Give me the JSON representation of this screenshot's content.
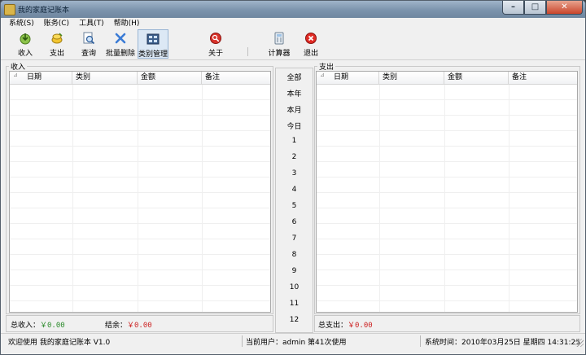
{
  "window": {
    "title": "我的家庭记账本"
  },
  "menu": [
    "系统(S)",
    "账务(C)",
    "工具(T)",
    "帮助(H)"
  ],
  "toolbar": [
    {
      "label": "收入",
      "icon": "income-icon"
    },
    {
      "label": "支出",
      "icon": "expense-icon"
    },
    {
      "label": "查询",
      "icon": "query-icon"
    },
    {
      "label": "批量删除",
      "icon": "batch-delete-icon"
    },
    {
      "label": "类别管理",
      "icon": "category-icon"
    },
    {
      "label": "关于",
      "icon": "about-icon"
    },
    {
      "label": "计算器",
      "icon": "calculator-icon"
    },
    {
      "label": "退出",
      "icon": "exit-icon"
    }
  ],
  "income": {
    "title": "收入",
    "columns": [
      "日期",
      "类别",
      "金额",
      "备注"
    ],
    "total_label": "总收入：",
    "total_value": "￥0.00",
    "balance_label": "结余：",
    "balance_value": "￥0.00"
  },
  "expense": {
    "title": "支出",
    "columns": [
      "日期",
      "类别",
      "金额",
      "备注"
    ],
    "total_label": "总支出：",
    "total_value": "￥0.00"
  },
  "range": [
    "全部",
    "本年",
    "本月",
    "今日",
    "1",
    "2",
    "3",
    "4",
    "5",
    "6",
    "7",
    "8",
    "9",
    "10",
    "11",
    "12"
  ],
  "status": {
    "welcome": "欢迎使用 我的家庭记账本 V1.0",
    "user": "当前用户：admin  第41次使用",
    "time": "系统时间：2010年03月25日  星期四 14:31:25"
  },
  "colors": {
    "positive": "#2a8a2a",
    "negative": "#cc1f1f"
  }
}
